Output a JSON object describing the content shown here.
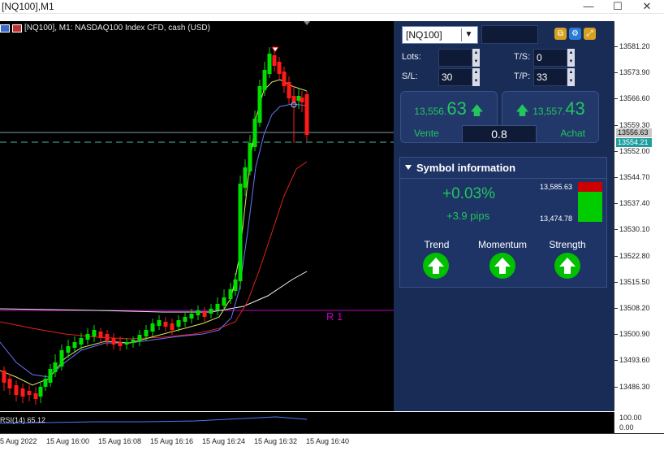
{
  "window": {
    "title": "[NQ100],M1",
    "controls": [
      "—",
      "☐",
      "✕"
    ]
  },
  "chart": {
    "header_text": "[NQ100], M1:  NASDAQ100 Index CFD, cash (USD)",
    "level_label": "R 1",
    "price_ticks": [
      "13581.20",
      "13573.90",
      "13566.60",
      "13559.30",
      "13552.00",
      "13544.70",
      "13537.40",
      "13530.10",
      "13522.80",
      "13515.50",
      "13508.20",
      "13500.90",
      "13493.60",
      "13486.30"
    ],
    "ask_tag": "13556.63",
    "bid_tag": "13554.21",
    "rsi_label": "RSI(14) 65.12",
    "rsi_ticks": [
      "100.00",
      "0.00"
    ],
    "time_labels": [
      "5 Aug 2022",
      "15 Aug 16:00",
      "15 Aug 16:08",
      "15 Aug 16:16",
      "15 Aug 16:24",
      "15 Aug 16:32",
      "15 Aug 16:40"
    ],
    "colors": {
      "bull": "#00e000",
      "bear": "#ff1a1a",
      "ma_fast": "#d8e86a",
      "ma_mid": "#6c74ff",
      "ma_slow": "#e02020",
      "ma_white": "#f2f2f2",
      "r1": "#c000c0"
    }
  },
  "panel": {
    "symbol": "[NQ100]",
    "lots_label": "Lots:",
    "lots_value": "",
    "ts_label": "T/S:",
    "ts_value": "0",
    "sl_label": "S/L:",
    "sl_value": "30",
    "tp_label": "T/P:",
    "tp_value": "33",
    "sell": {
      "price_small": "13,556.",
      "price_big": "63",
      "label": "Vente"
    },
    "buy": {
      "price_small": "13,557.",
      "price_big": "43",
      "label": "Achat"
    },
    "volume": "0.8"
  },
  "symbol_info": {
    "title": "Symbol information",
    "change_pct": "+0.03%",
    "change_pips": "+3.9 pips",
    "high": "13,585.63",
    "low": "13,474.78",
    "indicators": [
      {
        "label": "Trend",
        "direction": "up"
      },
      {
        "label": "Momentum",
        "direction": "up"
      },
      {
        "label": "Strength",
        "direction": "up"
      }
    ]
  }
}
